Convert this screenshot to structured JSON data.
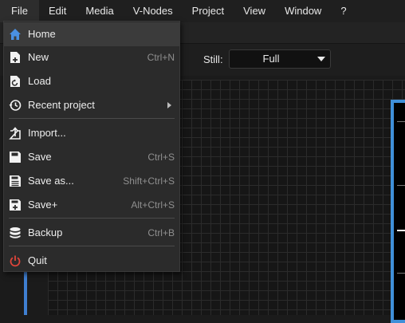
{
  "menubar": {
    "items": [
      "File",
      "Edit",
      "Media",
      "V-Nodes",
      "Project",
      "View",
      "Window",
      "?"
    ]
  },
  "toolbar": {
    "still_label": "Still:",
    "still_value": "Full"
  },
  "file_menu": {
    "items": [
      {
        "label": "Home",
        "shortcut": "",
        "icon": "home-icon"
      },
      {
        "label": "New",
        "shortcut": "Ctrl+N",
        "icon": "new-file-icon"
      },
      {
        "label": "Load",
        "shortcut": "",
        "icon": "load-icon"
      },
      {
        "label": "Recent project",
        "shortcut": "",
        "icon": "history-icon"
      },
      {
        "label": "Import...",
        "shortcut": "",
        "icon": "import-icon"
      },
      {
        "label": "Save",
        "shortcut": "Ctrl+S",
        "icon": "save-icon"
      },
      {
        "label": "Save as...",
        "shortcut": "Shift+Ctrl+S",
        "icon": "save-as-icon"
      },
      {
        "label": "Save+",
        "shortcut": "Alt+Ctrl+S",
        "icon": "save-plus-icon"
      },
      {
        "label": "Backup",
        "shortcut": "Ctrl+B",
        "icon": "database-icon"
      },
      {
        "label": "Quit",
        "shortcut": "",
        "icon": "power-icon"
      }
    ]
  },
  "colors": {
    "accent_blue": "#3f8fd8",
    "home_icon": "#4a90e2",
    "quit_icon": "#e0453a"
  }
}
